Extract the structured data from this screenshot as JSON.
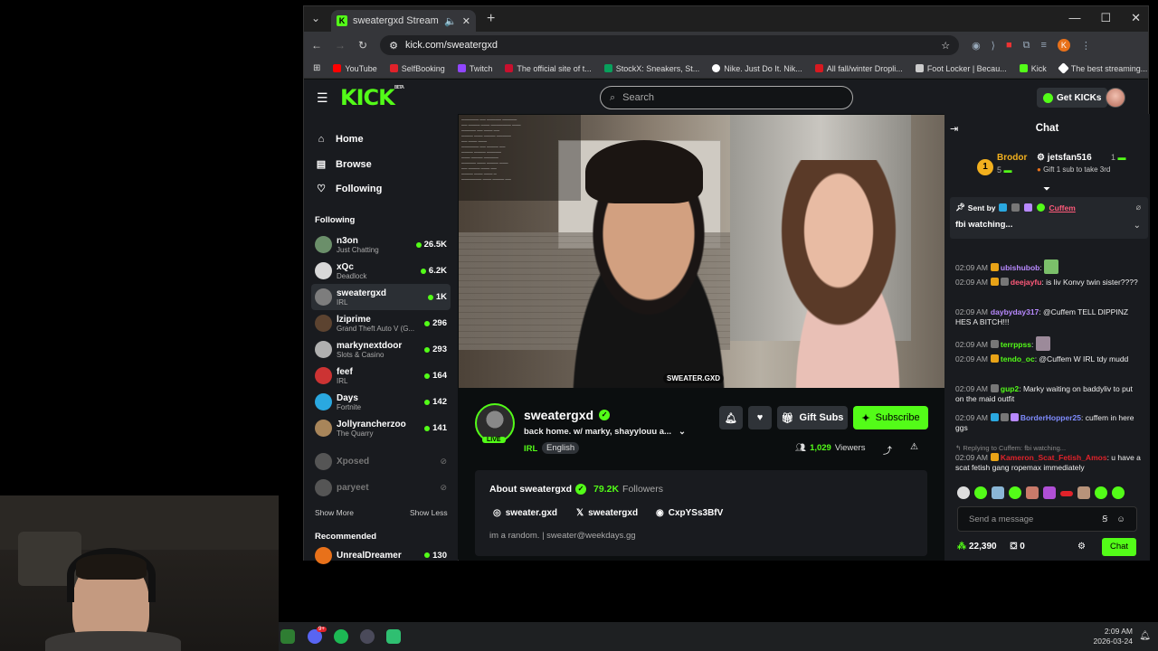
{
  "browser": {
    "tab_title": "sweatergxd Stream - Watch",
    "url": "kick.com/sweatergxd",
    "bookmarks": [
      {
        "label": "YouTube",
        "color": "#ff0000"
      },
      {
        "label": "SelfBooking",
        "color": "#e0222a"
      },
      {
        "label": "Twitch",
        "color": "#9146ff"
      },
      {
        "label": "The official site of t...",
        "color": "#c8102e"
      },
      {
        "label": "StockX: Sneakers, St...",
        "color": "#08a05c"
      },
      {
        "label": "Nike. Just Do It. Nik...",
        "color": "#ffffff"
      },
      {
        "label": "All fall/winter Dropli...",
        "color": "#d71920"
      },
      {
        "label": "Foot Locker | Becau...",
        "color": "#cccccc"
      },
      {
        "label": "Kick",
        "color": "#53fc18"
      },
      {
        "label": "The best streaming...",
        "color": "#ffffff"
      }
    ]
  },
  "header": {
    "logo": "KICK",
    "logo_sup": "BETA",
    "search_placeholder": "Search",
    "get_kicks": "Get KICKs"
  },
  "sidebar": {
    "nav": [
      {
        "label": "Home",
        "icon": "home-icon",
        "glyph": "⌂"
      },
      {
        "label": "Browse",
        "icon": "browse-icon",
        "glyph": "▤"
      },
      {
        "label": "Following",
        "icon": "heart-icon",
        "glyph": "♡"
      }
    ],
    "following_title": "Following",
    "channels": [
      {
        "name": "n3on",
        "category": "Just Chatting",
        "viewers": "26.5K",
        "live": true,
        "avatar": "#6b8f6a"
      },
      {
        "name": "xQc",
        "category": "Deadlock",
        "viewers": "6.2K",
        "live": true,
        "avatar": "#d8d8d8"
      },
      {
        "name": "sweatergxd",
        "category": "IRL",
        "viewers": "1K",
        "live": true,
        "avatar": "#7d7d7d"
      },
      {
        "name": "lziprime",
        "category": "Grand Theft Auto V (G...",
        "viewers": "296",
        "live": true,
        "avatar": "#5c4330"
      },
      {
        "name": "markynextdoor",
        "category": "Slots & Casino",
        "viewers": "293",
        "live": true,
        "avatar": "#b0b0b0"
      },
      {
        "name": "feef",
        "category": "IRL",
        "viewers": "164",
        "live": true,
        "avatar": "#c33"
      },
      {
        "name": "Days",
        "category": "Fortnite",
        "viewers": "142",
        "live": true,
        "avatar": "#2aa8e0"
      },
      {
        "name": "Jollyrancherzoo",
        "category": "The Quarry",
        "viewers": "141",
        "live": true,
        "avatar": "#a8855a"
      },
      {
        "name": "Xposed",
        "category": "",
        "viewers": "",
        "live": false,
        "avatar": "#555"
      },
      {
        "name": "paryeet",
        "category": "",
        "viewers": "",
        "live": false,
        "avatar": "#555"
      }
    ],
    "show_more": "Show More",
    "show_less": "Show Less",
    "recommended_title": "Recommended",
    "recommended": [
      {
        "name": "UnrealDreamer",
        "viewers": "130",
        "avatar": "#e8711a"
      }
    ]
  },
  "video": {
    "watermark": "SWEATER.GXD"
  },
  "stream": {
    "channel": "sweatergxd",
    "live_label": "LIVE",
    "title": "back home. w/ marky, shayylouu a...",
    "category": "IRL",
    "language": "English",
    "gift_subs": "Gift Subs",
    "subscribe": "Subscribe",
    "viewers": "1,029",
    "viewers_label": "Viewers"
  },
  "about": {
    "title": "About sweatergxd",
    "followers": "79.2K",
    "followers_label": "Followers",
    "instagram": "sweater.gxd",
    "x": "sweatergxd",
    "discord": "CxpYSs3BfV",
    "bio": "im a random. | sweater@weekdays.gg"
  },
  "chat": {
    "title": "Chat",
    "leaderboard": {
      "first_name": "Brodor",
      "first_count": "5",
      "second_name": "jetsfan516",
      "second_count": "1",
      "gift_note": "Gift 1 sub to take 3rd",
      "rank": "1"
    },
    "pinned": {
      "sent_by": "Sent by",
      "user": "Cuffem",
      "text": "fbi watching..."
    },
    "messages": [
      {
        "time": "02:09 AM",
        "user": "ubishubob",
        "color": "#b889ff",
        "text": ":",
        "emote": "#7bbf6a"
      },
      {
        "time": "02:09 AM",
        "user": "deejayfu",
        "color": "#ff5a7a",
        "text": ": is liv Konvy twin sister????",
        "emote": ""
      },
      {
        "time": "02:09 AM",
        "user": "daybyday317",
        "color": "#b889ff",
        "text": ": @Cuffem TELL DIPPINZ HES A BITCH!!!",
        "emote": ""
      },
      {
        "time": "02:09 AM",
        "user": "terrppss",
        "color": "#53fc18",
        "text": ":",
        "emote": "#9c8a9a"
      },
      {
        "time": "02:09 AM",
        "user": "tendo_oc",
        "color": "#53fc18",
        "text": ": @Cuffem W IRL tdy mudd",
        "emote": ""
      },
      {
        "time": "02:09 AM",
        "user": "gup2",
        "color": "#53fc18",
        "text": ": Marky waiting on baddyliv to put on the maid outfit",
        "emote": ""
      },
      {
        "time": "02:09 AM",
        "user": "BorderHopper25",
        "color": "#7f8cff",
        "text": ": cuffem in here ggs",
        "emote": ""
      },
      {
        "time": "02:09 AM",
        "user": "Kameron_Scat_Fetish_Amos",
        "color": "#e0222a",
        "text": ": u have a scat fetish gang ropemax immediately",
        "emote": "",
        "reply": "Replying to Cuffem: fbi watching..."
      }
    ],
    "input_placeholder": "Send a message",
    "points": "22,390",
    "gifts": "0",
    "chat_button": "Chat"
  },
  "taskbar": {
    "time": "2:09 AM",
    "date": "2026-03-24",
    "discord_badge": "9+"
  }
}
